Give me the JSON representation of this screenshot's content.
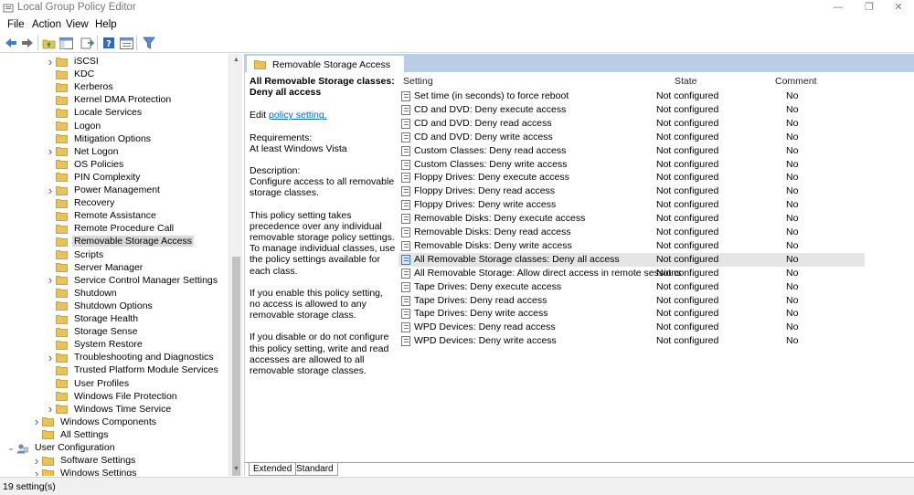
{
  "window": {
    "title": "Local Group Policy Editor",
    "minimize": "—",
    "restore": "❐",
    "close": "✕"
  },
  "menu": [
    "File",
    "Action",
    "View",
    "Help"
  ],
  "toolbar": {
    "icons": [
      "back-arrow-icon",
      "forward-arrow-icon",
      "up-folder-icon",
      "show-hide-tree-icon",
      "export-list-icon",
      "help-icon",
      "properties-icon",
      "filter-icon"
    ]
  },
  "tree": {
    "nodes": [
      {
        "label": "iSCSI",
        "expander": true
      },
      {
        "label": "KDC",
        "expander": false
      },
      {
        "label": "Kerberos",
        "expander": false
      },
      {
        "label": "Kernel DMA Protection",
        "expander": false
      },
      {
        "label": "Locale Services",
        "expander": false
      },
      {
        "label": "Logon",
        "expander": false
      },
      {
        "label": "Mitigation Options",
        "expander": false
      },
      {
        "label": "Net Logon",
        "expander": true
      },
      {
        "label": "OS Policies",
        "expander": false
      },
      {
        "label": "PIN Complexity",
        "expander": false
      },
      {
        "label": "Power Management",
        "expander": true
      },
      {
        "label": "Recovery",
        "expander": false
      },
      {
        "label": "Remote Assistance",
        "expander": false
      },
      {
        "label": "Remote Procedure Call",
        "expander": false
      },
      {
        "label": "Removable Storage Access",
        "expander": false,
        "selected": true
      },
      {
        "label": "Scripts",
        "expander": false
      },
      {
        "label": "Server Manager",
        "expander": false
      },
      {
        "label": "Service Control Manager Settings",
        "expander": true
      },
      {
        "label": "Shutdown",
        "expander": false
      },
      {
        "label": "Shutdown Options",
        "expander": false
      },
      {
        "label": "Storage Health",
        "expander": false
      },
      {
        "label": "Storage Sense",
        "expander": false
      },
      {
        "label": "System Restore",
        "expander": false
      },
      {
        "label": "Troubleshooting and Diagnostics",
        "expander": true
      },
      {
        "label": "Trusted Platform Module Services",
        "expander": false
      },
      {
        "label": "User Profiles",
        "expander": false
      },
      {
        "label": "Windows File Protection",
        "expander": false
      },
      {
        "label": "Windows Time Service",
        "expander": true
      },
      {
        "label": "Windows Components",
        "expander": true,
        "level": 1
      },
      {
        "label": "All Settings",
        "expander": false,
        "level": 1
      },
      {
        "label": "User Configuration",
        "expander": "open",
        "level": 0,
        "icon": "user-config"
      },
      {
        "label": "Software Settings",
        "expander": true,
        "level": 1
      },
      {
        "label": "Windows Settings",
        "expander": true,
        "level": 1
      }
    ]
  },
  "right": {
    "header": "Removable Storage Access",
    "description": {
      "heading": "All Removable Storage classes: Deny all access",
      "edit_prefix": "Edit ",
      "edit_link": "policy setting.",
      "requirements_label": "Requirements:",
      "requirements_value": "At least Windows Vista",
      "description_label": "Description:",
      "description_value": "Configure access to all removable storage classes.",
      "para1": "This policy setting takes precedence over any individual removable storage policy settings. To manage individual classes, use the policy settings available for each class.",
      "para2": "If you enable this policy setting, no access is allowed to any removable storage class.",
      "para3": "If you disable or do not configure this policy setting, write and read accesses are allowed to all removable storage classes."
    },
    "columns": {
      "setting": "Setting",
      "state": "State",
      "comment": "Comment"
    },
    "rows": [
      {
        "name": "Set time (in seconds) to force reboot",
        "state": "Not configured",
        "comment": "No"
      },
      {
        "name": "CD and DVD: Deny execute access",
        "state": "Not configured",
        "comment": "No"
      },
      {
        "name": "CD and DVD: Deny read access",
        "state": "Not configured",
        "comment": "No"
      },
      {
        "name": "CD and DVD: Deny write access",
        "state": "Not configured",
        "comment": "No"
      },
      {
        "name": "Custom Classes: Deny read access",
        "state": "Not configured",
        "comment": "No"
      },
      {
        "name": "Custom Classes: Deny write access",
        "state": "Not configured",
        "comment": "No"
      },
      {
        "name": "Floppy Drives: Deny execute access",
        "state": "Not configured",
        "comment": "No"
      },
      {
        "name": "Floppy Drives: Deny read access",
        "state": "Not configured",
        "comment": "No"
      },
      {
        "name": "Floppy Drives: Deny write access",
        "state": "Not configured",
        "comment": "No"
      },
      {
        "name": "Removable Disks: Deny execute access",
        "state": "Not configured",
        "comment": "No"
      },
      {
        "name": "Removable Disks: Deny read access",
        "state": "Not configured",
        "comment": "No"
      },
      {
        "name": "Removable Disks: Deny write access",
        "state": "Not configured",
        "comment": "No"
      },
      {
        "name": "All Removable Storage classes: Deny all access",
        "state": "Not configured",
        "comment": "No",
        "selected": true
      },
      {
        "name": "All Removable Storage: Allow direct access in remote sessions",
        "state": "Not configured",
        "comment": "No"
      },
      {
        "name": "Tape Drives: Deny execute access",
        "state": "Not configured",
        "comment": "No"
      },
      {
        "name": "Tape Drives: Deny read access",
        "state": "Not configured",
        "comment": "No"
      },
      {
        "name": "Tape Drives: Deny write access",
        "state": "Not configured",
        "comment": "No"
      },
      {
        "name": "WPD Devices: Deny read access",
        "state": "Not configured",
        "comment": "No"
      },
      {
        "name": "WPD Devices: Deny write access",
        "state": "Not configured",
        "comment": "No"
      }
    ],
    "tabs": [
      "Extended",
      "Standard"
    ]
  },
  "status": "19 setting(s)",
  "colors": {
    "header_band": "#b8cde6",
    "link": "#0066cc",
    "folder": "#e8c25a",
    "selection": "#e5e5e5"
  }
}
